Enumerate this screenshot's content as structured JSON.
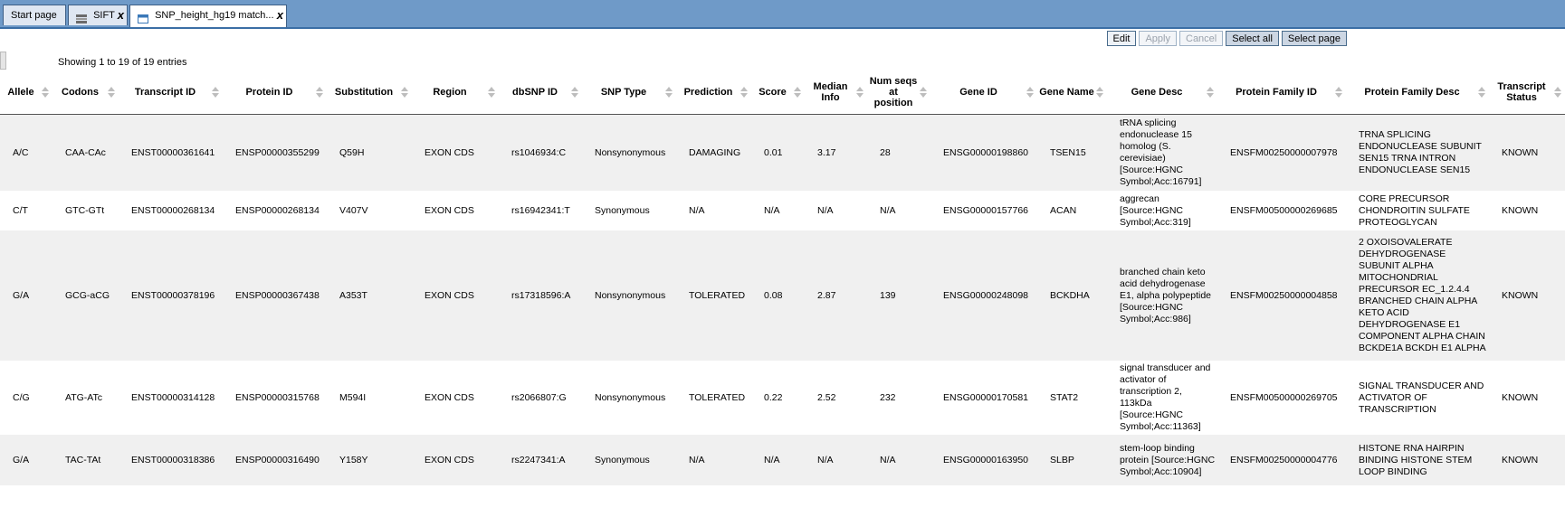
{
  "tabs": [
    {
      "label": "Start page"
    },
    {
      "label": "SIFT",
      "close": "x"
    },
    {
      "label": "SNP_height_hg19 match...",
      "close": "x"
    }
  ],
  "toolbar": {
    "edit": "Edit",
    "apply": "Apply",
    "cancel": "Cancel",
    "select_all": "Select all",
    "select_page": "Select page"
  },
  "showing": "Showing 1 to 19 of 19 entries",
  "columns": [
    "Allele",
    "Codons",
    "Transcript ID",
    "Protein ID",
    "Substitution",
    "Region",
    "dbSNP ID",
    "SNP Type",
    "Prediction",
    "Score",
    "Median Info",
    "Num seqs at position",
    "Gene ID",
    "Gene Name",
    "Gene Desc",
    "Protein Family ID",
    "Protein Family Desc",
    "Transcript Status"
  ],
  "rows": [
    [
      "A/C",
      "CAA-CAc",
      "ENST00000361641",
      "ENSP00000355299",
      "Q59H",
      "EXON CDS",
      "rs1046934:C",
      "Nonsynonymous",
      "DAMAGING",
      "0.01",
      "3.17",
      "28",
      "ENSG00000198860",
      "TSEN15",
      "tRNA splicing endonuclease 15 homolog (S. cerevisiae) [Source:HGNC Symbol;Acc:16791]",
      "ENSFM00250000007978",
      "TRNA SPLICING ENDONUCLEASE SUBUNIT SEN15 TRNA INTRON ENDONUCLEASE SEN15",
      "KNOWN"
    ],
    [
      "C/T",
      "GTC-GTt",
      "ENST00000268134",
      "ENSP00000268134",
      "V407V",
      "EXON CDS",
      "rs16942341:T",
      "Synonymous",
      "N/A",
      "N/A",
      "N/A",
      "N/A",
      "ENSG00000157766",
      "ACAN",
      "aggrecan [Source:HGNC Symbol;Acc:319]",
      "ENSFM00500000269685",
      "CORE PRECURSOR CHONDROITIN SULFATE PROTEOGLYCAN",
      "KNOWN"
    ],
    [
      "G/A",
      "GCG-aCG",
      "ENST00000378196",
      "ENSP00000367438",
      "A353T",
      "EXON CDS",
      "rs17318596:A",
      "Nonsynonymous",
      "TOLERATED",
      "0.08",
      "2.87",
      "139",
      "ENSG00000248098",
      "BCKDHA",
      "branched chain keto acid dehydrogenase E1, alpha polypeptide [Source:HGNC Symbol;Acc:986]",
      "ENSFM00250000004858",
      "2 OXOISOVALERATE DEHYDROGENASE SUBUNIT ALPHA MITOCHONDRIAL PRECURSOR EC_1.2.4.4 BRANCHED CHAIN ALPHA KETO ACID DEHYDROGENASE E1 COMPONENT ALPHA CHAIN BCKDE1A BCKDH E1 ALPHA",
      "KNOWN"
    ],
    [
      "C/G",
      "ATG-ATc",
      "ENST00000314128",
      "ENSP00000315768",
      "M594I",
      "EXON CDS",
      "rs2066807:G",
      "Nonsynonymous",
      "TOLERATED",
      "0.22",
      "2.52",
      "232",
      "ENSG00000170581",
      "STAT2",
      "signal transducer and activator of transcription 2, 113kDa [Source:HGNC Symbol;Acc:11363]",
      "ENSFM00500000269705",
      "SIGNAL TRANSDUCER AND ACTIVATOR OF TRANSCRIPTION",
      "KNOWN"
    ],
    [
      "G/A",
      "TAC-TAt",
      "ENST00000318386",
      "ENSP00000316490",
      "Y158Y",
      "EXON CDS",
      "rs2247341:A",
      "Synonymous",
      "N/A",
      "N/A",
      "N/A",
      "N/A",
      "ENSG00000163950",
      "SLBP",
      "stem-loop binding protein [Source:HGNC Symbol;Acc:10904]",
      "ENSFM00250000004776",
      "HISTONE RNA HAIRPIN BINDING HISTONE STEM LOOP BINDING",
      "KNOWN"
    ],
    [
      "",
      "",
      "",
      "",
      "",
      "",
      "",
      "",
      "",
      "",
      "",
      "",
      "",
      "",
      "",
      "",
      "",
      ""
    ]
  ]
}
